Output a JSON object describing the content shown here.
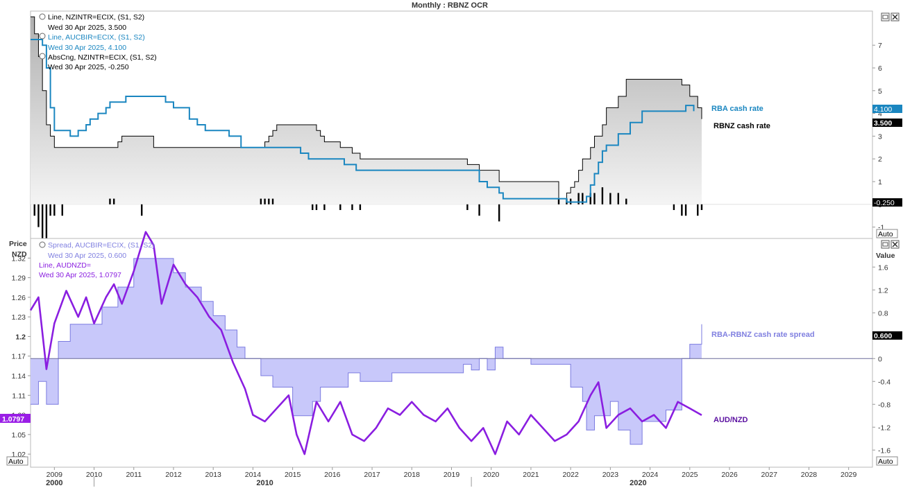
{
  "title": "Monthly : RBNZ OCR",
  "colors": {
    "rbnz": "#000000",
    "rba": "#1a86c0",
    "spread_fill": "#c8c8fa",
    "spread_line": "#7b7be0",
    "audnzd": "#8a1ee0",
    "audnzd_badge": "#9a1ee6"
  },
  "top_panel": {
    "legend": [
      {
        "line1": "Line, NZINTR=ECIX, (S1, S2)",
        "line2": "Wed 30 Apr 2025, 3.500"
      },
      {
        "line1": "Line, AUCBIR=ECIX, (S1, S2)",
        "line2": "Wed 30 Apr 2025, 4.100"
      },
      {
        "line1": "AbsCng, NZINTR=ECIX, (S1, S2)",
        "line2": "Wed 30 Apr 2025, -0.250"
      }
    ],
    "right_ticks": [
      "7",
      "6",
      "5",
      "4",
      "3",
      "2",
      "1",
      "0",
      "-1"
    ],
    "badges": {
      "rba": "4.100",
      "rbnz": "3.500",
      "abscng": "-0.250"
    },
    "series_labels": {
      "rba": "RBA cash rate",
      "rbnz": "RBNZ cash rate"
    },
    "auto_label": "Auto"
  },
  "bottom_panel": {
    "left_axis_title": [
      "Price",
      "NZD"
    ],
    "right_axis_title": "Value",
    "legend": [
      {
        "line1": "Spread, AUCBIR=ECIX, (S1, S2)",
        "line2": "Wed 30 Apr 2025, 0.600"
      },
      {
        "line1": "Line, AUDNZD=",
        "line2": "Wed 30 Apr 2025, 1.0797"
      }
    ],
    "left_ticks": [
      "1.32",
      "1.29",
      "1.26",
      "1.23",
      "1.2",
      "1.17",
      "1.14",
      "1.11",
      "1.08",
      "1.05",
      "1.02"
    ],
    "right_ticks": [
      "1.6",
      "1.2",
      "0.8",
      "0.4",
      "0",
      "-0.4",
      "-0.8",
      "-1.2",
      "-1.6"
    ],
    "badges": {
      "spread": "0.600",
      "audnzd": "1.0797"
    },
    "series_labels": {
      "spread": "RBA-RBNZ cash rate spread",
      "audnzd": "AUD/NZD"
    },
    "auto_label": "Auto"
  },
  "x_axis": {
    "years": [
      "2009",
      "2010",
      "2011",
      "2012",
      "2013",
      "2014",
      "2015",
      "2016",
      "2017",
      "2018",
      "2019",
      "2020",
      "2021",
      "2022",
      "2023",
      "2024",
      "2025",
      "2026",
      "2027",
      "2028",
      "2029"
    ],
    "decades": [
      "2000",
      "2010",
      "2020"
    ]
  },
  "chart_data": [
    {
      "type": "line",
      "series": [
        {
          "name": "NZINTR=ECIX",
          "x": [
            2008.4,
            2008.5,
            2008.6,
            2008.7,
            2008.8,
            2008.9,
            2009.0,
            2009.2,
            2009.3,
            2010.4,
            2010.6,
            2010.7,
            2011.2,
            2011.5,
            2013.0,
            2014.2,
            2014.3,
            2014.4,
            2014.5,
            2014.6,
            2015.5,
            2015.6,
            2015.7,
            2015.8,
            2016.2,
            2016.5,
            2016.7,
            2019.4,
            2019.7,
            2020.2,
            2021.7,
            2021.9,
            2022.0,
            2022.1,
            2022.2,
            2022.3,
            2022.5,
            2022.6,
            2022.8,
            2022.9,
            2023.2,
            2023.4,
            2024.6,
            2024.8,
            2025.0,
            2025.2,
            2025.3
          ],
          "y": [
            8.25,
            7.5,
            6.5,
            5.0,
            3.5,
            3.0,
            2.5,
            2.5,
            2.5,
            2.5,
            2.75,
            3.0,
            3.0,
            2.5,
            2.5,
            2.5,
            2.75,
            3.0,
            3.25,
            3.5,
            3.5,
            3.25,
            3.0,
            2.75,
            2.5,
            2.25,
            2.0,
            1.75,
            1.5,
            1.0,
            0.25,
            0.5,
            0.75,
            1.0,
            1.5,
            2.0,
            2.5,
            3.0,
            3.5,
            4.25,
            4.75,
            5.5,
            5.5,
            5.25,
            4.75,
            4.25,
            3.75
          ]
        },
        {
          "name": "AUCBIR=ECIX",
          "x": [
            2008.4,
            2008.7,
            2008.8,
            2008.9,
            2009.0,
            2009.4,
            2009.6,
            2009.8,
            2009.9,
            2010.1,
            2010.3,
            2010.4,
            2010.8,
            2011.8,
            2012.0,
            2012.4,
            2012.6,
            2012.8,
            2013.4,
            2013.7,
            2015.2,
            2015.4,
            2016.3,
            2016.6,
            2019.5,
            2019.7,
            2019.9,
            2020.2,
            2020.3,
            2021.9,
            2022.4,
            2022.5,
            2022.6,
            2022.7,
            2022.8,
            2022.9,
            2023.2,
            2023.5,
            2023.8,
            2024.9,
            2025.1
          ],
          "y": [
            7.25,
            7.0,
            6.0,
            4.25,
            3.25,
            3.0,
            3.25,
            3.5,
            3.75,
            4.0,
            4.25,
            4.5,
            4.75,
            4.5,
            4.25,
            3.75,
            3.5,
            3.25,
            3.0,
            2.5,
            2.25,
            2.0,
            1.75,
            1.5,
            1.5,
            1.0,
            0.75,
            0.5,
            0.25,
            0.1,
            0.35,
            0.85,
            1.35,
            1.85,
            2.35,
            2.6,
            3.1,
            3.6,
            4.1,
            4.35,
            4.1
          ]
        },
        {
          "name": "AbsCng NZINTR=ECIX",
          "type": "bar",
          "x": [
            2008.5,
            2008.6,
            2008.7,
            2008.8,
            2008.9,
            2009.0,
            2009.2,
            2010.4,
            2010.5,
            2011.2,
            2014.2,
            2014.3,
            2014.4,
            2014.5,
            2015.5,
            2015.6,
            2015.8,
            2016.2,
            2016.5,
            2016.7,
            2019.4,
            2019.7,
            2020.2,
            2021.7,
            2021.9,
            2022.0,
            2022.2,
            2022.3,
            2022.5,
            2022.6,
            2022.8,
            2023.0,
            2023.2,
            2023.4,
            2024.6,
            2024.8,
            2024.9,
            2025.2,
            2025.3
          ],
          "y": [
            -0.5,
            -1.0,
            -1.5,
            -1.5,
            -0.5,
            -0.5,
            -0.5,
            0.25,
            0.25,
            -0.5,
            0.25,
            0.25,
            0.25,
            0.25,
            -0.25,
            -0.25,
            -0.25,
            -0.25,
            -0.25,
            -0.25,
            -0.25,
            -0.5,
            -0.75,
            0.25,
            0.25,
            0.25,
            0.5,
            0.5,
            0.5,
            0.5,
            0.75,
            0.5,
            0.5,
            0.25,
            -0.25,
            -0.5,
            -0.5,
            -0.5,
            -0.25
          ]
        }
      ],
      "ylim": [
        -1.5,
        8.5
      ],
      "xlim": [
        2008.4,
        2029.6
      ]
    },
    {
      "type": "area",
      "series": [
        {
          "name": "Spread AUCBIR-NZINTR",
          "x": [
            2008.4,
            2008.6,
            2008.8,
            2009.1,
            2009.4,
            2009.8,
            2010.2,
            2010.6,
            2011.0,
            2011.5,
            2012.0,
            2012.3,
            2012.7,
            2013.0,
            2013.3,
            2013.6,
            2013.8,
            2014.2,
            2014.5,
            2015.0,
            2015.5,
            2015.7,
            2016.0,
            2016.4,
            2016.7,
            2017.5,
            2019.3,
            2019.5,
            2019.7,
            2019.9,
            2020.1,
            2020.3,
            2021.0,
            2021.8,
            2022.0,
            2022.3,
            2022.4,
            2022.6,
            2022.8,
            2023.0,
            2023.2,
            2023.5,
            2023.8,
            2024.4,
            2024.8,
            2025.0,
            2025.3
          ],
          "y": [
            -0.8,
            -0.4,
            -0.8,
            0.3,
            0.6,
            0.6,
            0.9,
            1.25,
            1.75,
            1.75,
            1.5,
            1.25,
            1.0,
            0.75,
            0.5,
            0.2,
            0.0,
            -0.3,
            -0.5,
            -1.0,
            -0.75,
            -0.5,
            -0.5,
            -0.25,
            -0.4,
            -0.25,
            -0.1,
            -0.2,
            0.0,
            -0.2,
            0.2,
            0.0,
            -0.1,
            -0.1,
            -0.5,
            -0.75,
            -1.25,
            -1.0,
            -1.0,
            -0.75,
            -1.25,
            -1.5,
            -1.1,
            -0.9,
            0.0,
            0.25,
            0.6
          ]
        },
        {
          "name": "AUDNZD=",
          "x": [
            2008.4,
            2008.6,
            2008.8,
            2009.0,
            2009.3,
            2009.6,
            2009.8,
            2010.0,
            2010.3,
            2010.5,
            2010.7,
            2011.0,
            2011.3,
            2011.5,
            2011.7,
            2012.0,
            2012.3,
            2012.6,
            2012.9,
            2013.2,
            2013.5,
            2013.8,
            2014.0,
            2014.3,
            2014.6,
            2014.9,
            2015.1,
            2015.3,
            2015.6,
            2015.9,
            2016.2,
            2016.5,
            2016.8,
            2017.1,
            2017.4,
            2017.7,
            2018.0,
            2018.3,
            2018.6,
            2018.9,
            2019.2,
            2019.5,
            2019.8,
            2020.1,
            2020.4,
            2020.7,
            2021.0,
            2021.3,
            2021.6,
            2021.9,
            2022.2,
            2022.5,
            2022.7,
            2022.9,
            2023.2,
            2023.5,
            2023.8,
            2024.1,
            2024.4,
            2024.7,
            2025.0,
            2025.3
          ],
          "y": [
            1.24,
            1.26,
            1.15,
            1.22,
            1.27,
            1.23,
            1.26,
            1.22,
            1.26,
            1.28,
            1.25,
            1.3,
            1.36,
            1.34,
            1.25,
            1.31,
            1.28,
            1.26,
            1.23,
            1.21,
            1.16,
            1.12,
            1.08,
            1.07,
            1.09,
            1.11,
            1.05,
            1.02,
            1.1,
            1.07,
            1.1,
            1.05,
            1.04,
            1.06,
            1.09,
            1.08,
            1.1,
            1.08,
            1.07,
            1.09,
            1.06,
            1.04,
            1.06,
            1.02,
            1.07,
            1.05,
            1.08,
            1.06,
            1.04,
            1.05,
            1.07,
            1.11,
            1.13,
            1.06,
            1.08,
            1.09,
            1.07,
            1.08,
            1.06,
            1.1,
            1.09,
            1.0797
          ]
        }
      ],
      "ylim_left": [
        1.0,
        1.35
      ],
      "ylim_right": [
        -1.9,
        2.1
      ],
      "xlim": [
        2008.4,
        2029.6
      ]
    }
  ]
}
